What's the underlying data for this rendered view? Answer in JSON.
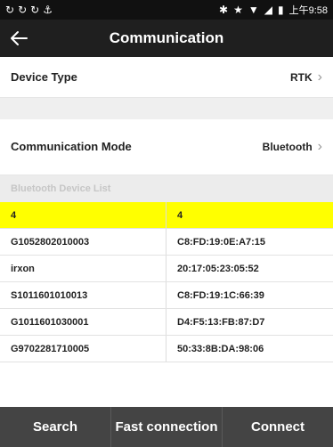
{
  "status_bar": {
    "time": "上午9:58",
    "left_icons": [
      "sync-icon",
      "sync-icon",
      "sync-icon",
      "usb-icon"
    ],
    "right_icons": [
      "bluetooth-icon",
      "star-icon",
      "wifi-icon",
      "signal-icon",
      "battery-icon"
    ]
  },
  "app_bar": {
    "title": "Communication",
    "back_icon": "arrow-left-icon"
  },
  "settings": {
    "device_type": {
      "label": "Device Type",
      "value": "RTK"
    },
    "communication_mode": {
      "label": "Communication Mode",
      "value": "Bluetooth"
    }
  },
  "device_list": {
    "header": "Bluetooth Device List",
    "columns": [
      "4",
      "4"
    ],
    "rows": [
      [
        "G1052802010003",
        "C8:FD:19:0E:A7:15"
      ],
      [
        "irxon",
        "20:17:05:23:05:52"
      ],
      [
        "S1011601010013",
        "C8:FD:19:1C:66:39"
      ],
      [
        "G1011601030001",
        "D4:F5:13:FB:87:D7"
      ],
      [
        "G9702281710005",
        "50:33:8B:DA:98:06"
      ]
    ]
  },
  "bottom_bar": {
    "search": "Search",
    "fast_connection": "Fast connection",
    "connect": "Connect"
  },
  "colors": {
    "app_bar": "#1f1f1f",
    "highlight": "#ffff00",
    "bottom_bar": "#444444"
  }
}
